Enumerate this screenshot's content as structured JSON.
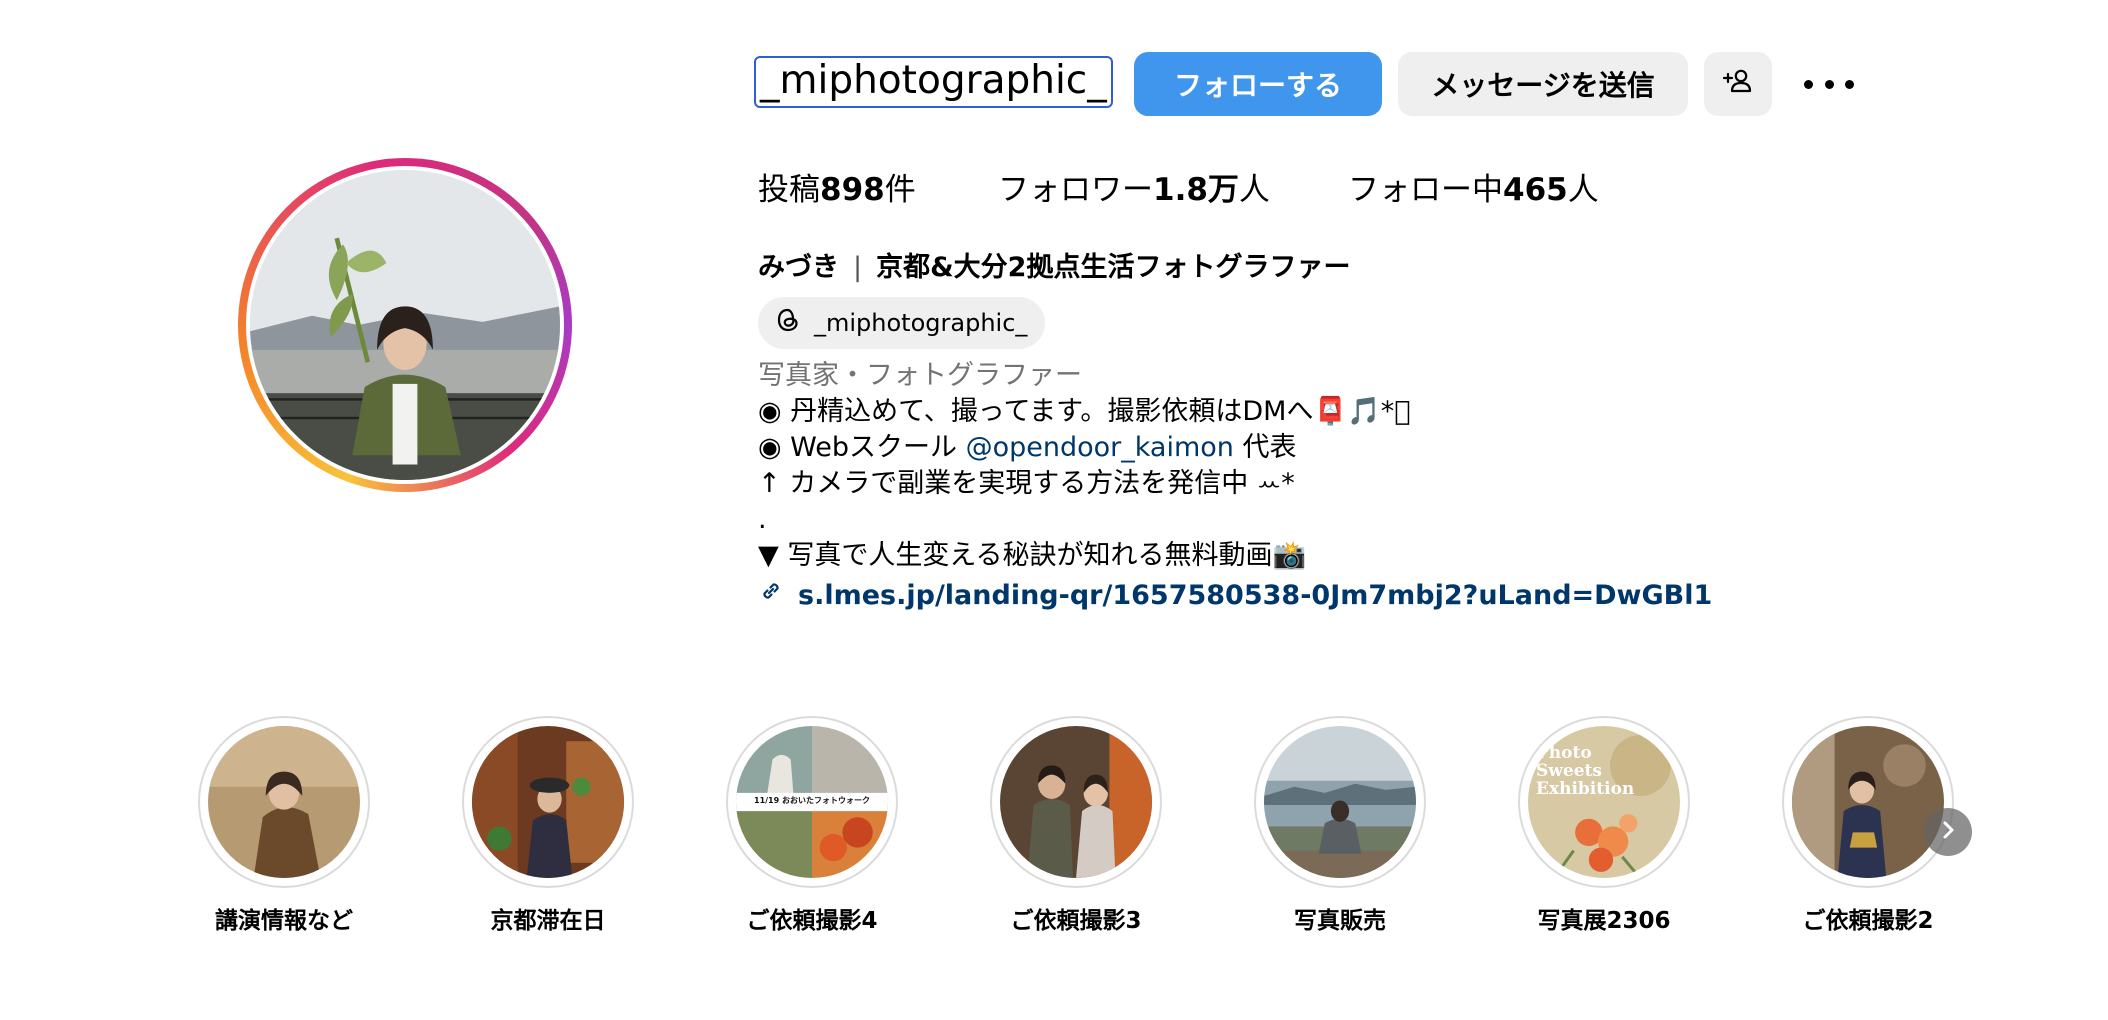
{
  "profile": {
    "username": "_miphotographic_",
    "follow_label": "フォローする",
    "message_label": "メッセージを送信",
    "stats": {
      "posts_prefix": "投稿",
      "posts_count": "898",
      "posts_suffix": "件",
      "followers_prefix": "フォロワー",
      "followers_count": "1.8万",
      "followers_suffix": "人",
      "following_prefix": "フォロー中",
      "following_count": "465",
      "following_suffix": "人"
    },
    "display_name": "みづき",
    "name_separator": "|",
    "headline": "京都&大分2拠点生活フォトグラファー",
    "threads_handle": "_miphotographic_",
    "bio": {
      "category": "写真家・フォトグラファー",
      "line1": "◉ 丹精込めて、撮ってます。撮影依頼はDMへ📮🎵*ﾟ",
      "line2_prefix": "◉ Webスクール ",
      "line2_mention": "@opendoor_kaimon",
      "line2_suffix": " 代表",
      "line3": "↑ カメラで副業を実現する方法を発信中 ꕀ*",
      "line4": ".",
      "line5": "▼ 写真で人生変える秘訣が知れる無料動画📸"
    },
    "link": "s.lmes.jp/landing-qr/1657580538-0Jm7mbj2?uLand=DwGBl1"
  },
  "highlights": [
    {
      "label": "講演情報など"
    },
    {
      "label": "京都滞在日"
    },
    {
      "label": "ご依頼撮影4",
      "overlay_text": "11/19 おおいたフォトウォーク"
    },
    {
      "label": "ご依頼撮影3"
    },
    {
      "label": "写真販売"
    },
    {
      "label": "写真展2306",
      "overlay_text": "Photo Sweets Exhibition"
    },
    {
      "label": "ご依頼撮影2"
    }
  ],
  "colors": {
    "accent_blue": "#4096ec",
    "link_blue": "#00376b",
    "secondary_button": "#efefef",
    "muted_text": "#737373"
  }
}
